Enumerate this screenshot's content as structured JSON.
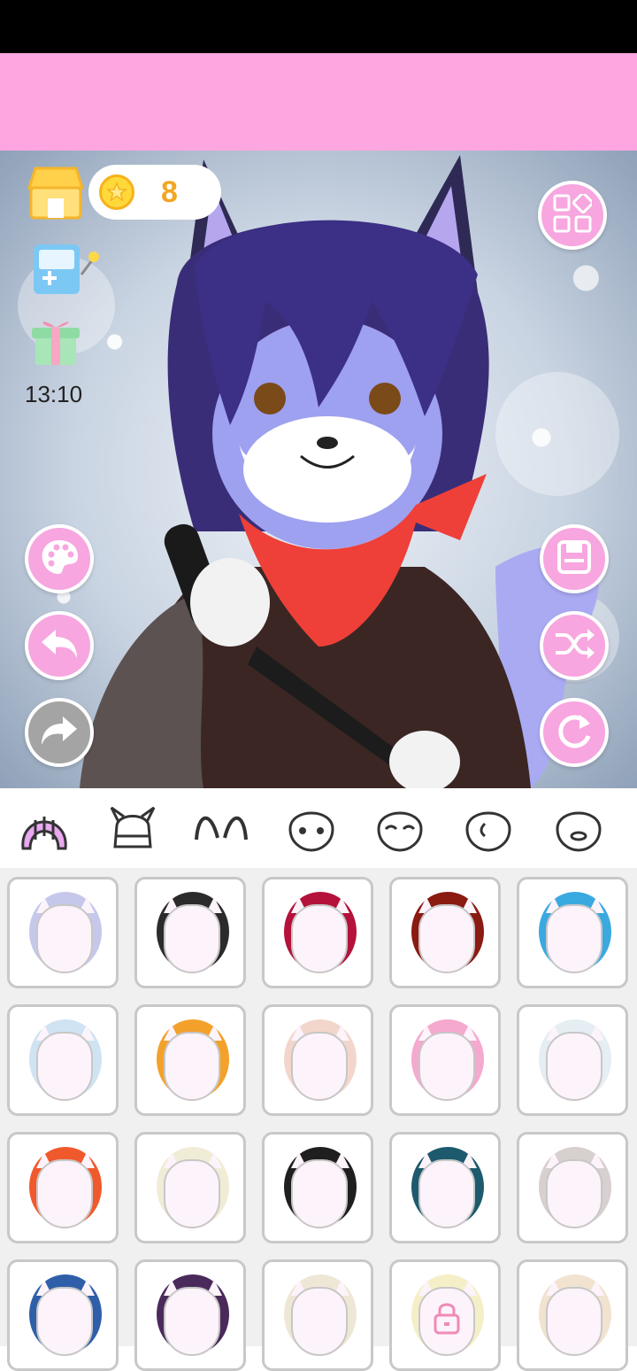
{
  "hud": {
    "coin_count": "8",
    "time": "13:10"
  },
  "icons": {
    "shop": "shop-icon",
    "game": "game-machine-icon",
    "gift": "gift-icon",
    "menu": "grid-menu-icon",
    "palette": "palette-icon",
    "undo": "undo-icon",
    "redo": "redo-icon",
    "save": "save-icon",
    "random": "shuffle-icon",
    "reset": "reset-icon"
  },
  "colors": {
    "banner": "#fda6e0",
    "button": "#f7a6df",
    "disabled_button": "#a4a4a4",
    "coin": "#f2a623",
    "selected_tab": "#e9a8f0"
  },
  "tabs": [
    "hair",
    "hat",
    "ears",
    "face",
    "eyes-closed",
    "side-face",
    "mouth"
  ],
  "hair_items": [
    {
      "color": "#c5c8ea",
      "locked": false
    },
    {
      "color": "#2b2b2b",
      "locked": false
    },
    {
      "color": "#b4123a",
      "locked": false
    },
    {
      "color": "#8a1a12",
      "locked": false
    },
    {
      "color": "#3aa9e0",
      "locked": false
    },
    {
      "color": "#cfe3f3",
      "locked": false
    },
    {
      "color": "#f3a12b",
      "locked": false
    },
    {
      "color": "#f2d6cc",
      "locked": false
    },
    {
      "color": "#f5a9cf",
      "locked": false
    },
    {
      "color": "#e5eef2",
      "locked": false
    },
    {
      "color": "#f0592b",
      "locked": false
    },
    {
      "color": "#f1ecd6",
      "locked": false
    },
    {
      "color": "#1f1f1f",
      "locked": false
    },
    {
      "color": "#1d5a6e",
      "locked": false
    },
    {
      "color": "#d8cfcf",
      "locked": false
    },
    {
      "color": "#2f5fa8",
      "locked": false
    },
    {
      "color": "#4a2a5a",
      "locked": false
    },
    {
      "color": "#efe7d6",
      "locked": false
    },
    {
      "color": "#f5efc8",
      "locked": true
    },
    {
      "color": "#f1e3d0",
      "locked": false
    }
  ]
}
